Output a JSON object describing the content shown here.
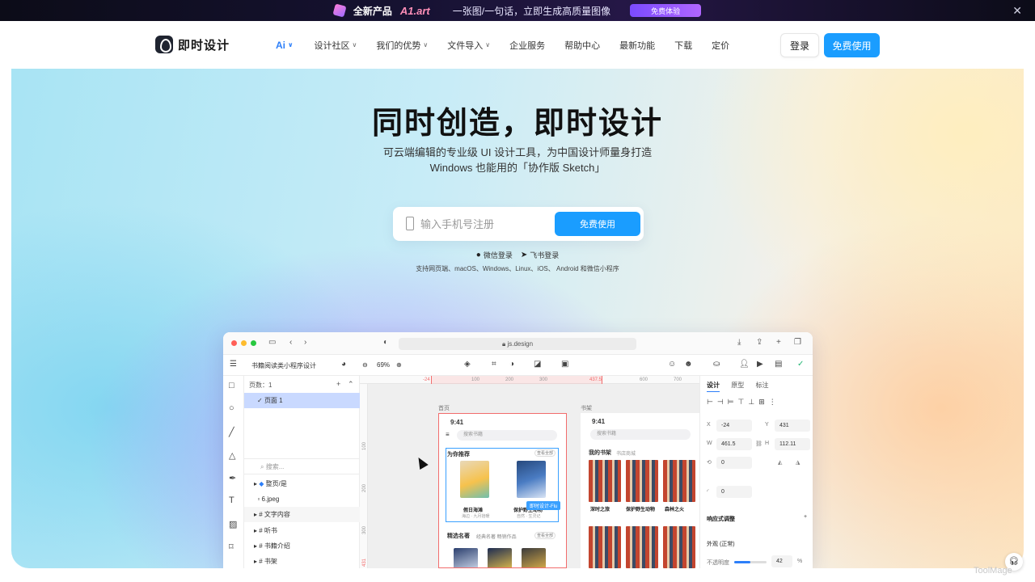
{
  "promo": {
    "prefix": "全新产品",
    "brand": "A1.art",
    "text": "一张图/一句话，立即生成高质量图像",
    "button": "免费体验"
  },
  "nav": {
    "logo": "即时设计",
    "items": [
      "Ai",
      "设计社区",
      "我们的优势",
      "文件导入",
      "企业服务",
      "帮助中心",
      "最新功能",
      "下载",
      "定价"
    ],
    "login": "登录",
    "free": "免费使用"
  },
  "hero": {
    "title": "同时创造，即时设计",
    "subtitle_1": "可云端编辑的专业级 UI 设计工具，为中国设计师量身打造",
    "subtitle_2": "Windows 也能用的「协作版 Sketch」",
    "phone_placeholder": "输入手机号注册",
    "signup_button": "免费使用",
    "wechat_login": "微信登录",
    "feishu_login": "飞书登录",
    "platforms": "支持网页端、macOS、Windows、Linux、iOS、 Android 和微信小程序"
  },
  "app": {
    "url": "js.design",
    "file_name": "书籍阅读类小程序设计",
    "zoom": "69%",
    "pages_label": "页数：1",
    "page_1": "页面 1",
    "search_placeholder": "搜索...",
    "layers": [
      "整页/是",
      "6.jpeg",
      "文字内容",
      "听书",
      "书籍介绍",
      "书架"
    ],
    "ruler_h": [
      "-24",
      "100",
      "200",
      "300",
      "437.5",
      "600",
      "700"
    ],
    "ruler_v": [
      "100",
      "200",
      "300",
      "431"
    ],
    "frame_home": "首页",
    "frame_shelf": "书架",
    "time": "9:41",
    "search_hint": "搜索书籍",
    "recommend": "为你推荐",
    "more": "查看全部",
    "book_1": "假日海滩",
    "book_1_sub": "海边 · 九月拾暖",
    "book_2": "保护野生动物",
    "book_2_sub": "自然 · 生灵记",
    "collab_tag": "即时设计-Flu",
    "section_2": "精选名著",
    "section_2_tabs": "经典名著  畅销作品",
    "my_shelf": "我的书架",
    "shelf_tab": "书店商城",
    "poster_1": "深时之旅",
    "poster_2": "保护野生动物",
    "poster_3": "森林之火",
    "props_tabs": [
      "设计",
      "原型",
      "标注"
    ],
    "x": "-24",
    "y": "431",
    "w": "461.5",
    "h": "112.11",
    "rotation": "0",
    "radius": "0",
    "responsive": "响应式调整",
    "appearance": "外观 (正常)",
    "opacity_label": "不透明度",
    "opacity": "42",
    "opacity_unit": "%"
  },
  "footer": {
    "watermark": "ToolMage"
  }
}
